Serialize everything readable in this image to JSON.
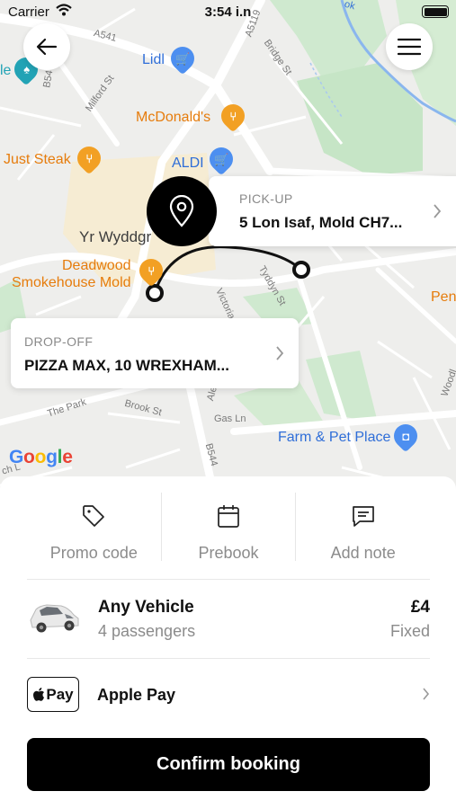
{
  "status_bar": {
    "carrier": "Carrier",
    "time": "3:54 i.n"
  },
  "map": {
    "labels": {
      "lidl": "Lidl",
      "mcdonalds": "McDonald's",
      "aldi": "ALDI",
      "just_steak": "Just Steak",
      "town": "Yr Wyddgr",
      "deadwood": "Deadwood",
      "smokehouse": "Smokehouse Mold",
      "farm_pet": "Farm & Pet Place",
      "pen": "Pen",
      "le": "le"
    },
    "streets": {
      "a541": "A541",
      "a5119": "A5119",
      "b54_top": "B54",
      "milford": "Milford St",
      "bridge": "Bridge St",
      "victoria": "Victoria",
      "tyddyn": "Tyddyn St",
      "the_park": "The Park",
      "brook": "Brook St",
      "gas": "Gas Ln",
      "b5444": "B544",
      "alex": "Ale",
      "woodl": "Woodl",
      "ch": "ch L",
      "ok": "ok"
    },
    "google": [
      "G",
      "o",
      "o",
      "g",
      "l",
      "e"
    ],
    "google_colors": [
      "#4285F4",
      "#EA4335",
      "#FBBC05",
      "#4285F4",
      "#34A853",
      "#EA4335"
    ]
  },
  "pickup": {
    "kind": "PICK-UP",
    "address": "5 Lon Isaf, Mold CH7..."
  },
  "dropoff": {
    "kind": "DROP-OFF",
    "address": "PIZZA MAX, 10 WREXHAM..."
  },
  "actions": {
    "promo": "Promo code",
    "prebook": "Prebook",
    "note": "Add note"
  },
  "vehicle": {
    "name": "Any Vehicle",
    "passengers": "4 passengers",
    "price": "£4",
    "price_type": "Fixed"
  },
  "payment": {
    "badge": "Pay",
    "name": "Apple Pay"
  },
  "confirm_label": "Confirm booking",
  "icons": [
    "back-arrow-icon",
    "hamburger-menu-icon",
    "location-pin-icon",
    "chevron-right-icon",
    "tag-icon",
    "calendar-icon",
    "message-icon",
    "car-icon",
    "apple-logo-icon",
    "wifi-icon",
    "battery-icon"
  ]
}
